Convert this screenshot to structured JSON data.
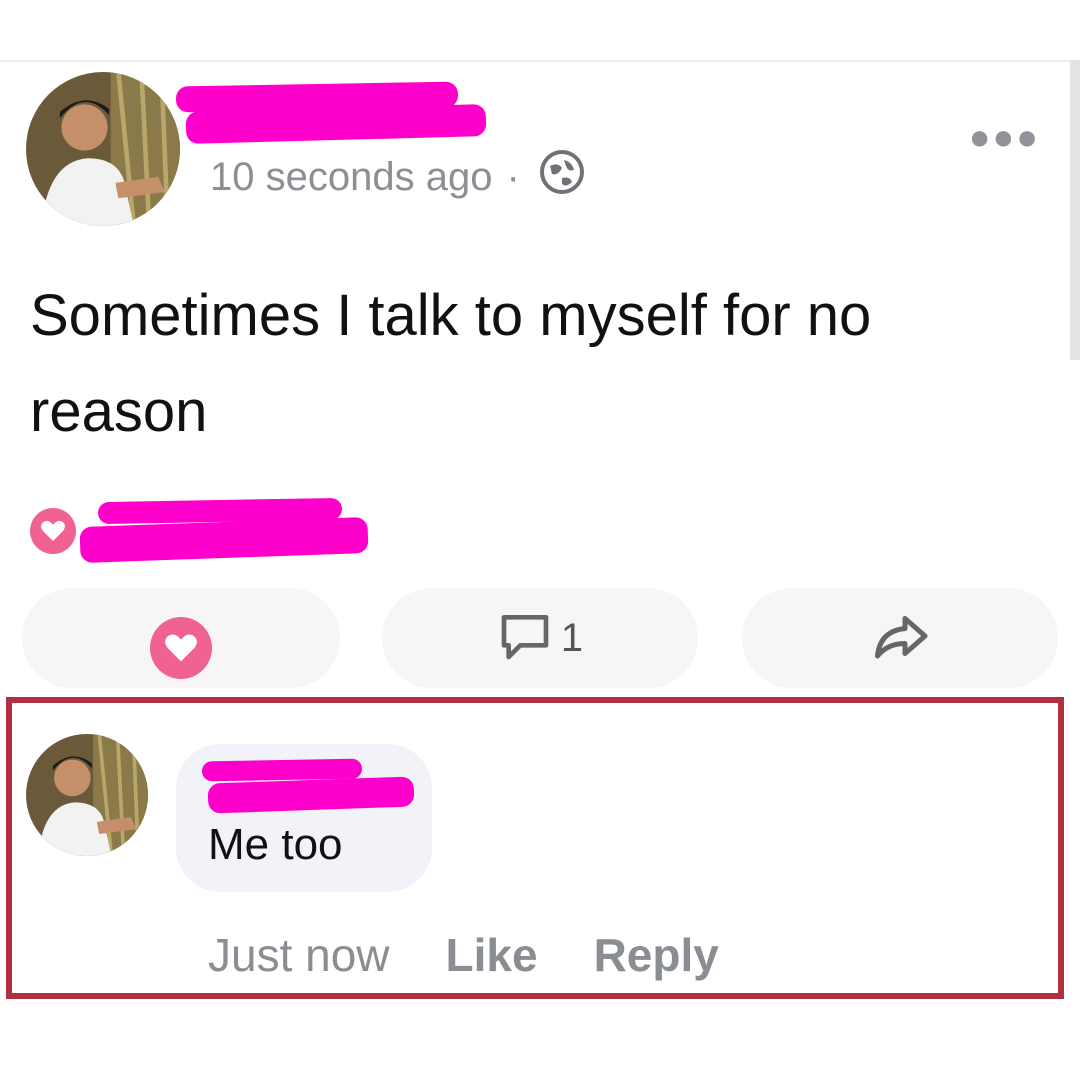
{
  "post": {
    "timestamp": "10 seconds ago",
    "separator": "·",
    "text": "Sometimes I talk to myself for no reason",
    "comment_count": "1"
  },
  "comment": {
    "text": "Me too",
    "time": "Just now",
    "like_label": "Like",
    "reply_label": "Reply"
  },
  "icons": {
    "more": "more-options-icon",
    "privacy": "globe-icon",
    "reaction": "heart-icon",
    "comment": "comment-icon",
    "share": "share-icon"
  },
  "colors": {
    "heart": "#f06292",
    "highlight_border": "#b03041",
    "redaction": "#ff00cc",
    "meta_text": "#8a8d91"
  }
}
